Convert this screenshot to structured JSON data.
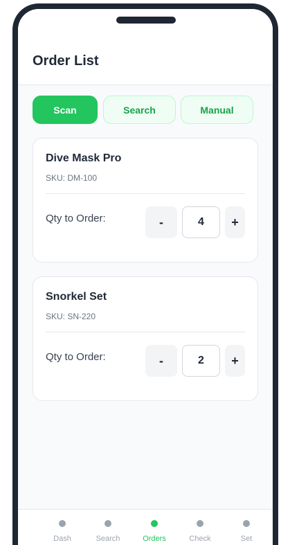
{
  "header": {
    "title": "Order List"
  },
  "modes": [
    {
      "label": "Scan",
      "active": true
    },
    {
      "label": "Search",
      "active": false
    },
    {
      "label": "Manual",
      "active": false
    }
  ],
  "items": [
    {
      "name": "Dive Mask Pro",
      "sku": "SKU: DM-100",
      "qty_label": "Qty to Order:",
      "qty": "4",
      "minus": "-",
      "plus": "+"
    },
    {
      "name": "Snorkel Set",
      "sku": "SKU: SN-220",
      "qty_label": "Qty to Order:",
      "qty": "2",
      "minus": "-",
      "plus": "+"
    }
  ],
  "nav": [
    {
      "label": "Dash",
      "active": false
    },
    {
      "label": "Search",
      "active": false
    },
    {
      "label": "Orders",
      "active": true
    },
    {
      "label": "Check",
      "active": false
    },
    {
      "label": "Set",
      "active": false
    }
  ],
  "colors": {
    "accent": "#22c55e",
    "accent_light": "#f0fdf4",
    "frame": "#1f2733"
  }
}
